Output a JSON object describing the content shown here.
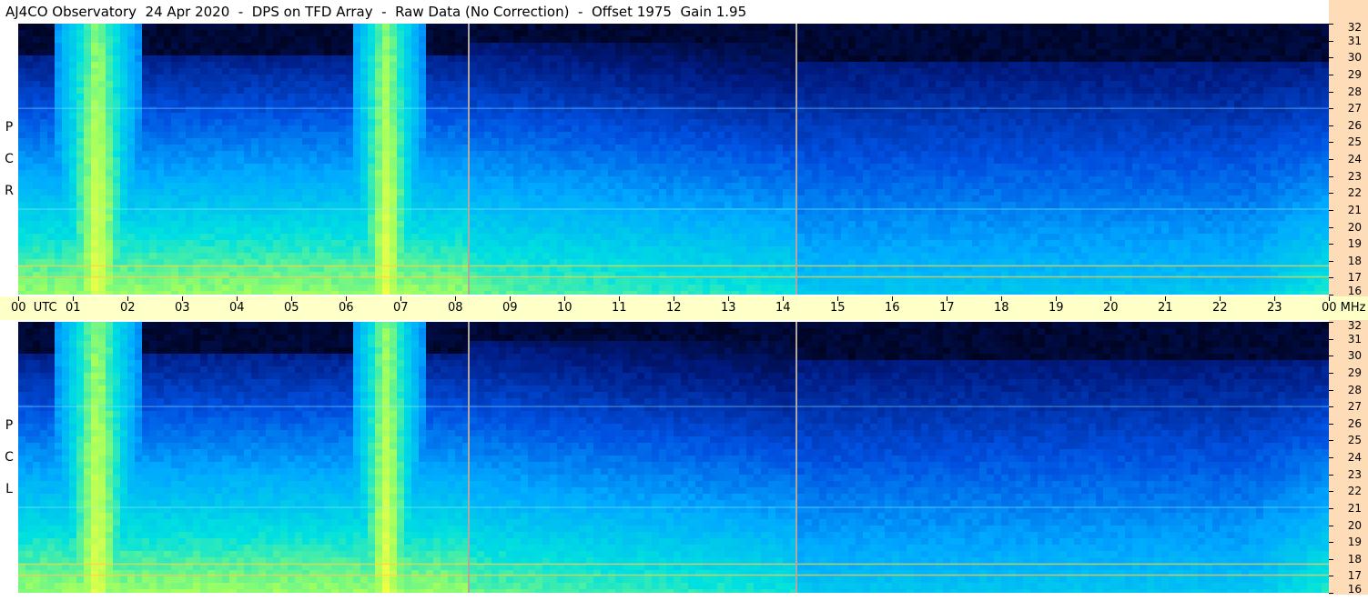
{
  "title": "AJ4CO Observatory  24 Apr 2020  -  DPS on TFD Array  -  Raw Data (No Correction)  -  Offset 1975  Gain 1.95",
  "panels": [
    {
      "name": "RCP",
      "letters": [
        "P",
        "C",
        "R"
      ]
    },
    {
      "name": "LCP",
      "letters": [
        "P",
        "C",
        "L"
      ]
    }
  ],
  "chart_data": {
    "type": "heatmap",
    "title": "AJ4CO Observatory  24 Apr 2020  -  DPS on TFD Array  -  Raw Data (No Correction)  -  Offset 1975  Gain 1.95",
    "x_axis": {
      "unit": "UTC",
      "tick_labels": [
        "00",
        "01",
        "02",
        "03",
        "04",
        "05",
        "06",
        "07",
        "08",
        "09",
        "10",
        "11",
        "12",
        "13",
        "14",
        "15",
        "16",
        "17",
        "18",
        "19",
        "20",
        "21",
        "22",
        "23",
        "00"
      ],
      "first_label_suffix": "UTC",
      "last_label_suffix": "MHz",
      "range_hours": [
        0,
        24
      ]
    },
    "y_axis": {
      "unit": "MHz",
      "tick_labels": [
        "32",
        "31",
        "30",
        "29",
        "28",
        "27",
        "26",
        "25",
        "24",
        "23",
        "22",
        "21",
        "20",
        "19",
        "18",
        "17",
        "16"
      ],
      "range": [
        16,
        32
      ]
    },
    "panels": [
      "RCP",
      "LCP"
    ],
    "colormap": [
      "#000010",
      "#001a80",
      "#0050e0",
      "#00a8ff",
      "#00e0e0",
      "#a0ff60",
      "#ffff40",
      "#ff8000",
      "#ff2000"
    ],
    "features": {
      "bright_bands_utc": [
        [
          0.7,
          2.2
        ],
        [
          6.1,
          7.4
        ]
      ],
      "gap_markers_utc": [
        8.25,
        14.25
      ],
      "interference_lines_mhz": [
        17.05,
        17.7,
        21.05,
        27.0
      ]
    }
  }
}
